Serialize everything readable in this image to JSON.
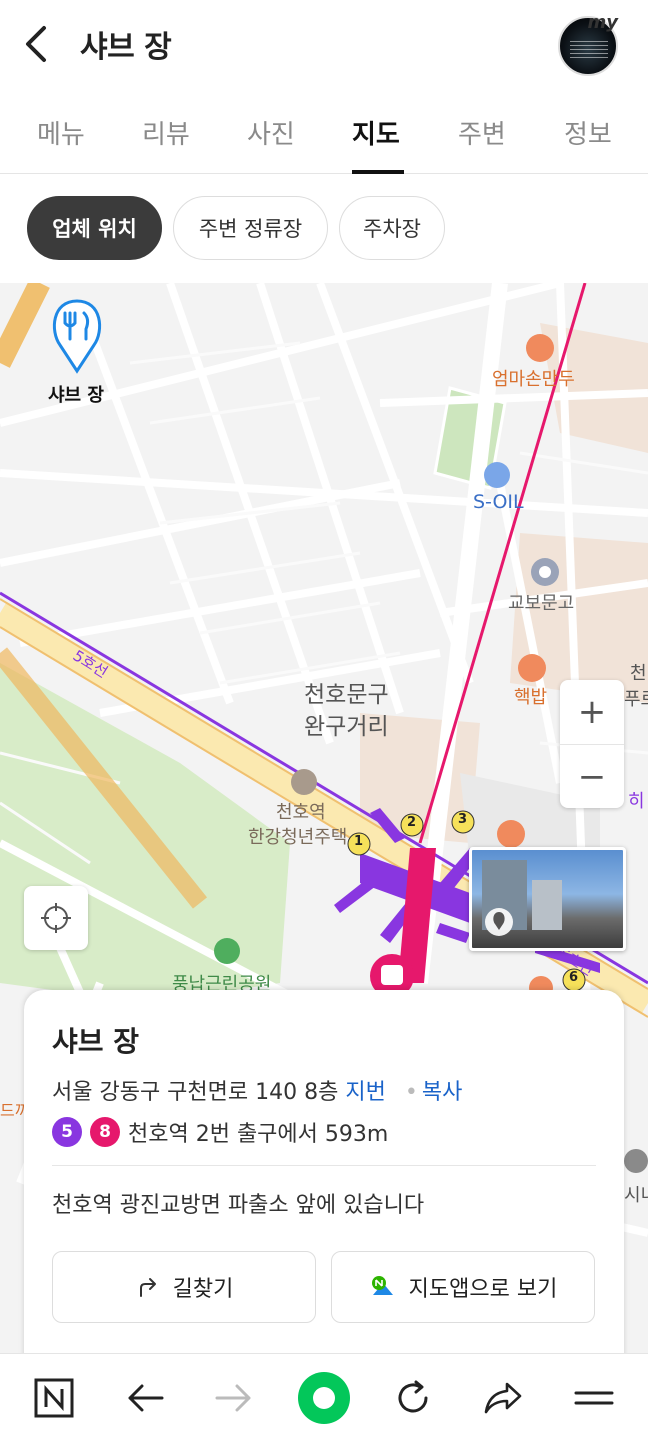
{
  "header": {
    "title": "샤브 장",
    "avatar_badge": "my"
  },
  "tabs": [
    {
      "label": "메뉴",
      "active": false
    },
    {
      "label": "리뷰",
      "active": false
    },
    {
      "label": "사진",
      "active": false
    },
    {
      "label": "지도",
      "active": true
    },
    {
      "label": "주변",
      "active": false
    },
    {
      "label": "정보",
      "active": false
    }
  ],
  "chips": [
    {
      "label": "업체 위치",
      "active": true
    },
    {
      "label": "주변 정류장",
      "active": false
    },
    {
      "label": "주차장",
      "active": false
    }
  ],
  "map": {
    "marker_label": "샤브 장",
    "labels": {
      "restaurant_1": "엄마손만두",
      "gas_station": "S-OIL",
      "bookstore": "교보문고",
      "restaurant_2": "핵밥",
      "district_line1": "천호문구",
      "district_line2": "완구거리",
      "housing_line1": "천호역",
      "housing_line2": "한강청년주택",
      "park": "풍납근린공원",
      "subway_line_5a": "5호선",
      "subway_line_5b": "5호선",
      "edge_right_1": "천",
      "edge_right_2": "푸르",
      "edge_right_3": "히",
      "edge_right_4": "시니",
      "edge_left_1": "드끼",
      "exits": [
        "1",
        "2",
        "3",
        "6"
      ]
    },
    "colors": {
      "line5": "#8936e0",
      "line8": "#e6186c",
      "water_road": "#f0c070",
      "park": "#d8ecc8",
      "link": "#1a63c9"
    }
  },
  "zoom": {
    "plus": "+",
    "minus": "−"
  },
  "card": {
    "name": "샤브 장",
    "address": "서울 강동구 구천면로 140 8층",
    "jibun_link": "지번",
    "copy_link": "복사",
    "line_badges": [
      {
        "label": "5",
        "color": "#8936e0"
      },
      {
        "label": "8",
        "color": "#e6186c"
      }
    ],
    "subway_text": "천호역 2번 출구에서 593m",
    "description": "천호역 광진교방면 파출소 앞에 있습니다",
    "directions_button": "길찾기",
    "map_app_button": "지도앱으로 보기"
  },
  "bottom_bar": {
    "icons": [
      "naver-n-icon",
      "arrow-left-icon",
      "arrow-right-icon",
      "green-dot-icon",
      "refresh-icon",
      "share-icon",
      "menu-icon"
    ]
  }
}
